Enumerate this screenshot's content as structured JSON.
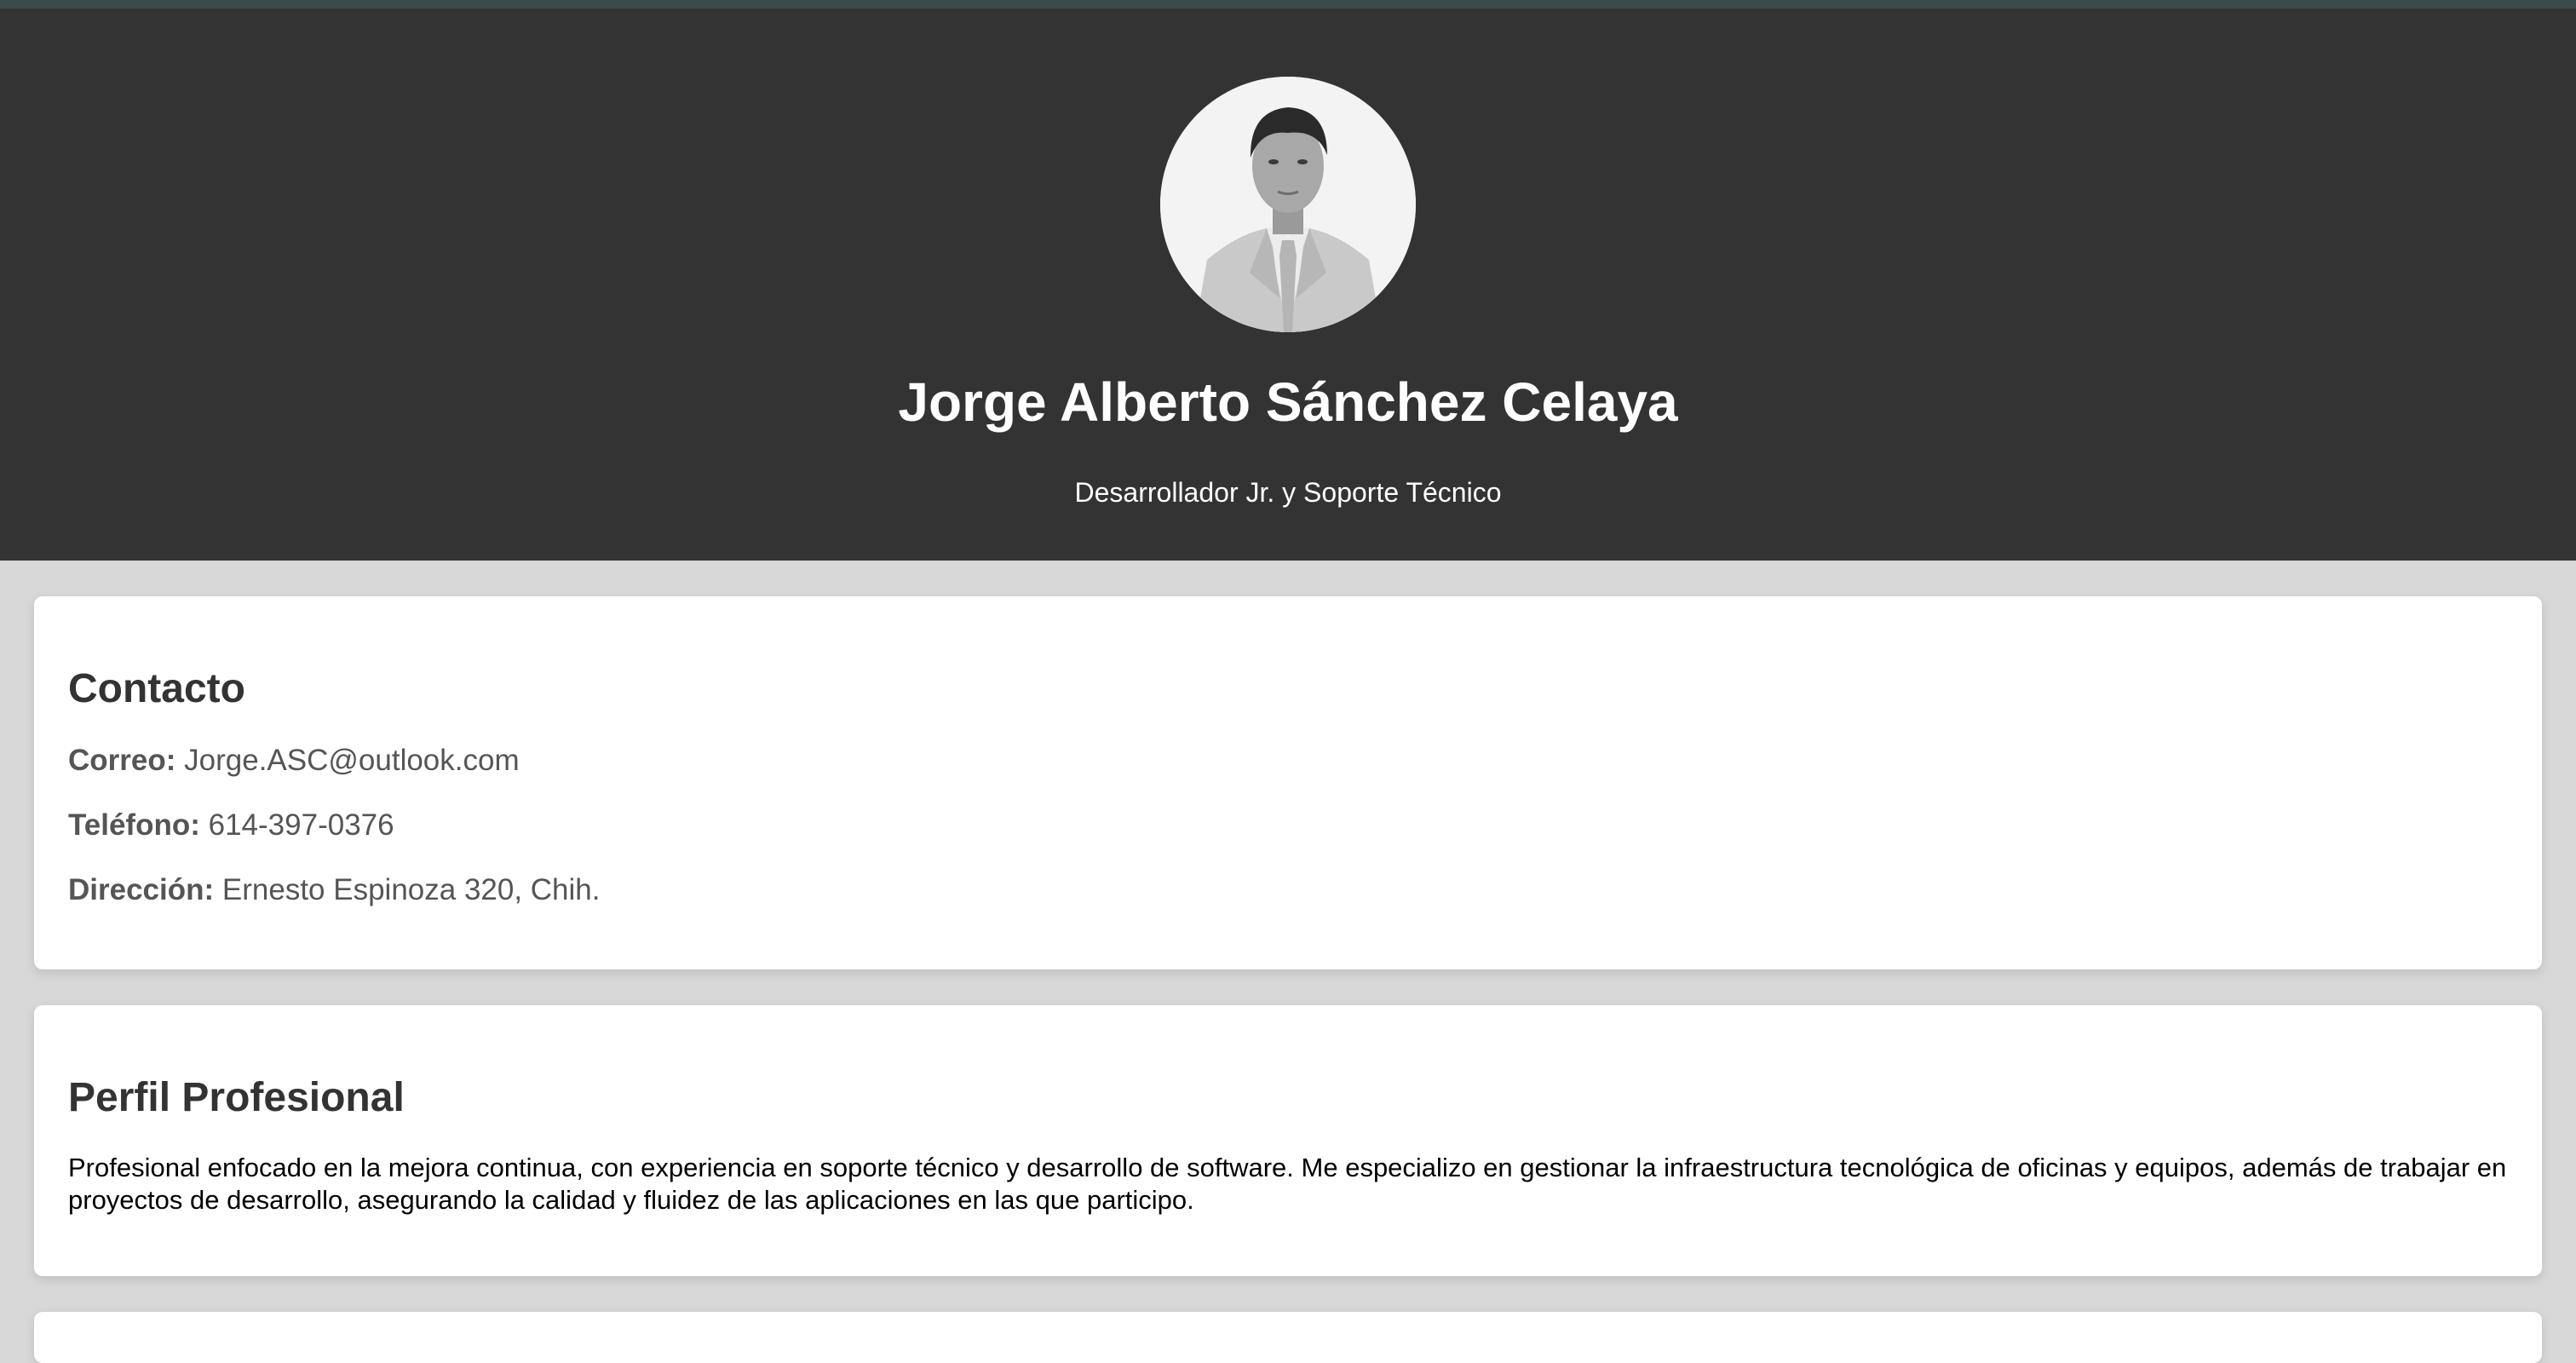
{
  "header": {
    "name": "Jorge Alberto Sánchez Celaya",
    "role": "Desarrollador Jr. y Soporte Técnico"
  },
  "contact": {
    "title": "Contacto",
    "email_label": "Correo:",
    "email_value": "Jorge.ASC@outlook.com",
    "phone_label": "Teléfono:",
    "phone_value": "614-397-0376",
    "address_label": "Dirección:",
    "address_value": "Ernesto Espinoza 320, Chih."
  },
  "profile": {
    "title": "Perfil Profesional",
    "text": "Profesional enfocado en la mejora continua, con experiencia en soporte técnico y desarrollo de software. Me especializo en gestionar la infraestructura tecnológica de oficinas y equipos, además de trabajar en proyectos de desarrollo, asegurando la calidad y fluidez de las aplicaciones en las que participo."
  },
  "colors": {
    "hero_background": "#333333",
    "page_background": "#d8d8d8",
    "card_background": "#ffffff",
    "heading_text": "#333333"
  }
}
